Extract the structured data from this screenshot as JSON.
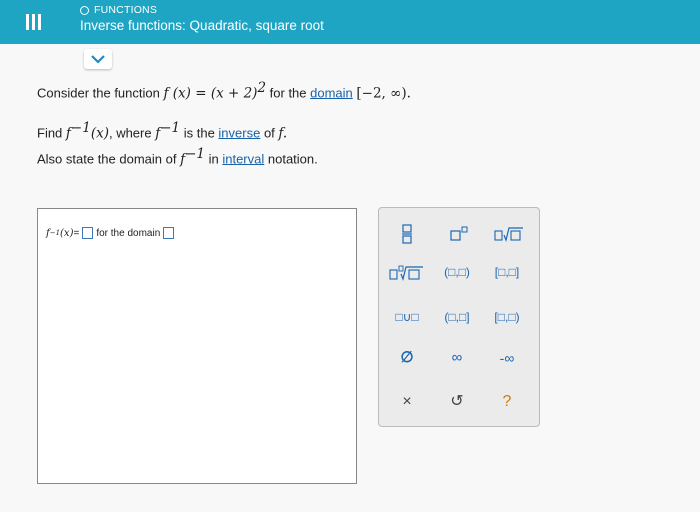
{
  "header": {
    "topic": "FUNCTIONS",
    "title": "Inverse functions: Quadratic, square root"
  },
  "question": {
    "line1_pre": "Consider the function",
    "line1_func": "f (x) = (x + 2)",
    "line1_exp": "2",
    "line1_mid": " for the ",
    "line1_link": "domain",
    "line1_interval": "[−2, ∞).",
    "line2_pre": "Find ",
    "line2_f": "f",
    "line2_sup": "−1",
    "line2_arg": "(x)",
    "line2_mid": ", where ",
    "line2_f2": "f",
    "line2_sup2": "−1",
    "line2_post": " is the ",
    "line2_link": "inverse",
    "line2_end": " of ",
    "line2_fend": "f.",
    "line3_pre": "Also state the domain of ",
    "line3_f": "f",
    "line3_sup": "−1",
    "line3_mid": " in ",
    "line3_link": "interval",
    "line3_end": " notation."
  },
  "answer": {
    "lhs_f": "f",
    "lhs_sup": "−1",
    "lhs_arg": "(x)",
    "eq": " = ",
    "for_domain": "for the domain"
  },
  "palette": {
    "interval_open_open": "(□,□)",
    "interval_closed_closed": "[□,□]",
    "interval_open_closed": "(□,□]",
    "interval_closed_open": "[□,□)",
    "union": "□∪□",
    "empty_set": "∅",
    "infinity": "∞",
    "neg_infinity": "-∞",
    "clear": "×",
    "undo": "↺",
    "help": "?"
  }
}
